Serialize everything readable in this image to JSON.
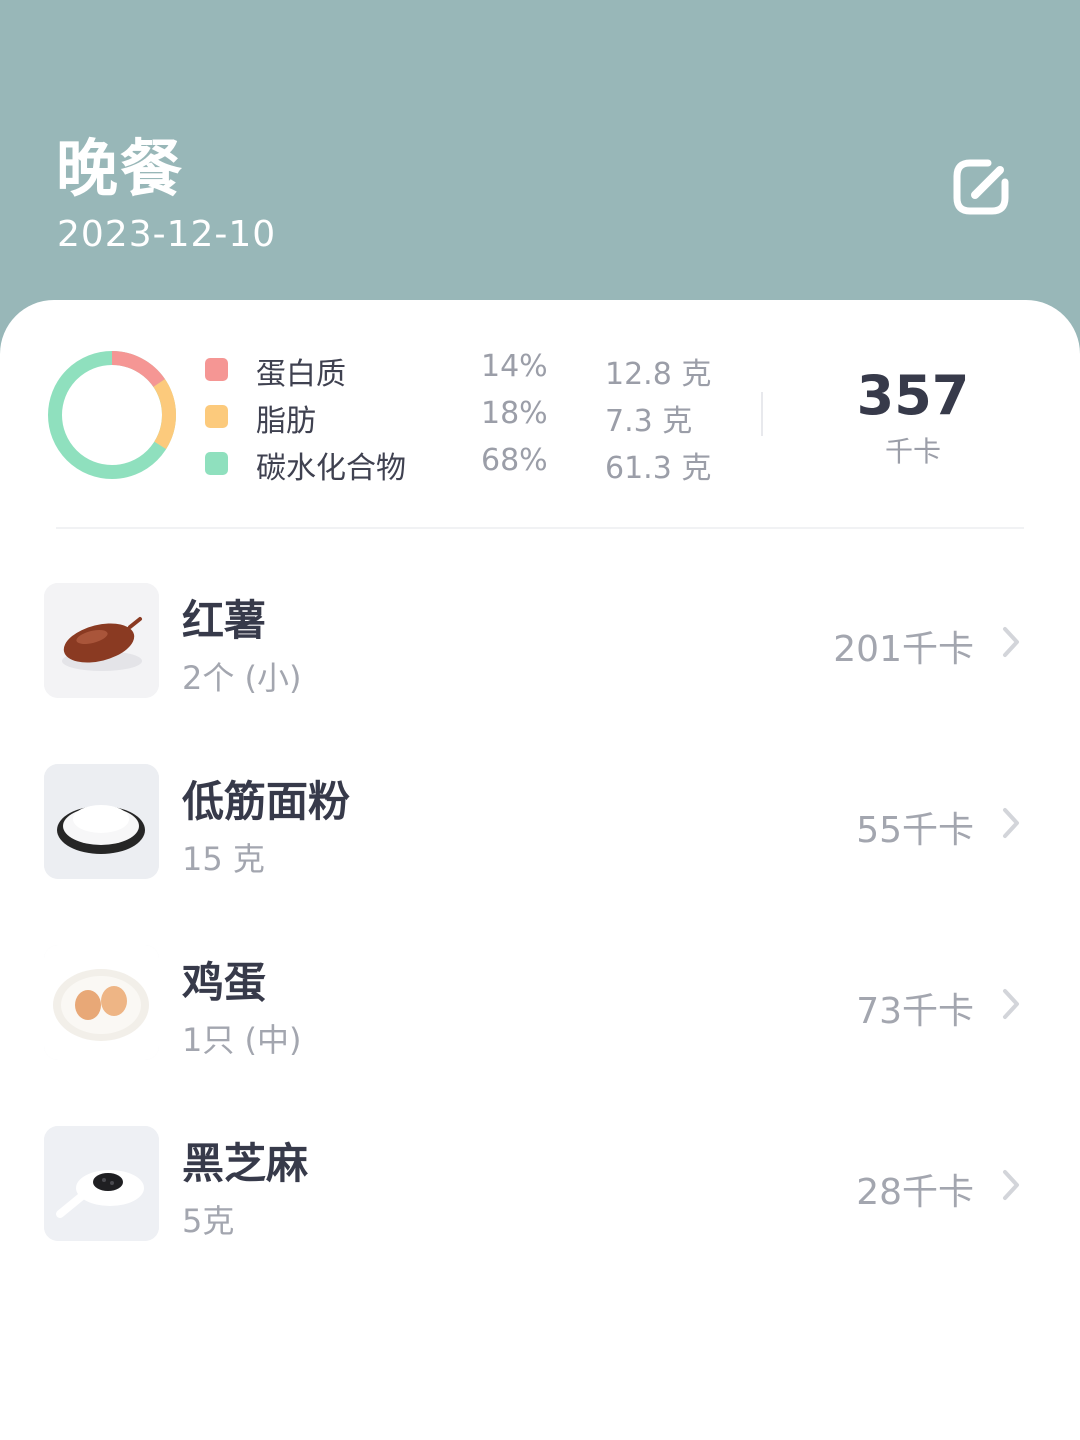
{
  "header": {
    "title": "晚餐",
    "date": "2023-12-10"
  },
  "summary": {
    "macros": [
      {
        "name": "蛋白质",
        "percent": "14%",
        "amount": "12.8 克",
        "color": "#f59694"
      },
      {
        "name": "脂肪",
        "percent": "18%",
        "amount": "7.3 克",
        "color": "#fcca7c"
      },
      {
        "name": "碳水化合物",
        "percent": "68%",
        "amount": "61.3 克",
        "color": "#8fe0be"
      }
    ],
    "total_value": "357",
    "total_unit": "千卡"
  },
  "foods": [
    {
      "name": "红薯",
      "portion": "2个 (小)",
      "kcal": "201千卡",
      "icon": "sweet-potato-icon"
    },
    {
      "name": "低筋面粉",
      "portion": "15 克",
      "kcal": "55千卡",
      "icon": "flour-icon"
    },
    {
      "name": "鸡蛋",
      "portion": "1只 (中)",
      "kcal": "73千卡",
      "icon": "eggs-icon"
    },
    {
      "name": "黑芝麻",
      "portion": "5克",
      "kcal": "28千卡",
      "icon": "black-sesame-icon"
    }
  ],
  "colors": {
    "header_bg": "#98b7b8",
    "text_dark": "#373a4a",
    "text_muted": "#a3a6af"
  }
}
